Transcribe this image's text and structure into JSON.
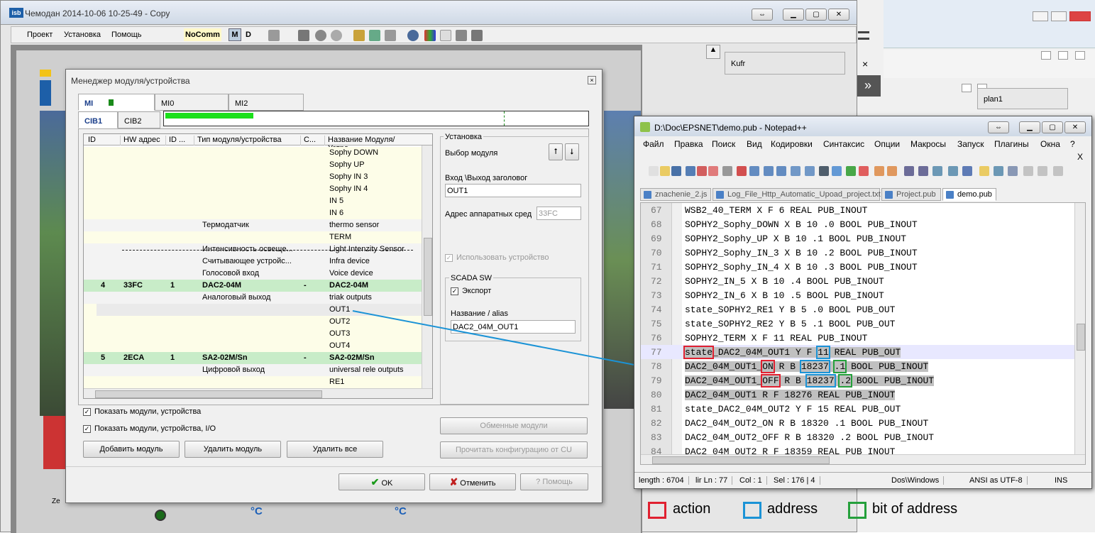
{
  "main": {
    "title": "Чемодан 2014-10-06 10-25-49 - Copy",
    "logo": "isb",
    "menu": [
      "Проект",
      "Установка",
      "Помощь"
    ],
    "nocomm": "NoComm",
    "mode_m": "M",
    "mode_d": "D"
  },
  "right_panel": {
    "kufr": "Kufr",
    "plan": "plan1"
  },
  "dialog": {
    "title": "Менеджер модуля/устройства",
    "tabs_top": [
      "MI",
      "MI0",
      "MI2"
    ],
    "tabs_bottom": [
      "CIB1",
      "CIB2"
    ],
    "columns": [
      "ID",
      "HW адрес",
      "ID ...",
      "Тип модуля/устройства",
      "C...",
      "Название Модуля/Устро..."
    ],
    "rows": [
      {
        "style": "y",
        "id": "",
        "hw": "",
        "idm": "",
        "type": "",
        "c": "",
        "name": "Sophy DOWN"
      },
      {
        "style": "y",
        "id": "",
        "hw": "",
        "idm": "",
        "type": "",
        "c": "",
        "name": "Sophy UP"
      },
      {
        "style": "y",
        "id": "",
        "hw": "",
        "idm": "",
        "type": "",
        "c": "",
        "name": "Sophy IN 3"
      },
      {
        "style": "y",
        "id": "",
        "hw": "",
        "idm": "",
        "type": "",
        "c": "",
        "name": "Sophy IN 4"
      },
      {
        "style": "y",
        "id": "",
        "hw": "",
        "idm": "",
        "type": "",
        "c": "",
        "name": "IN 5"
      },
      {
        "style": "y",
        "id": "",
        "hw": "",
        "idm": "",
        "type": "",
        "c": "",
        "name": "IN 6"
      },
      {
        "style": "w",
        "id": "",
        "hw": "",
        "idm": "",
        "type": "Термодатчик",
        "c": "",
        "name": "thermo sensor"
      },
      {
        "style": "y",
        "id": "",
        "hw": "",
        "idm": "",
        "type": "",
        "c": "",
        "name": "TERM"
      },
      {
        "style": "w",
        "id": "",
        "hw": "",
        "idm": "",
        "type": "Интенсивность освеще...",
        "c": "",
        "name": "Light Intenzity Sensor"
      },
      {
        "style": "w",
        "id": "",
        "hw": "",
        "idm": "",
        "type": "Считывающее устройс...",
        "c": "",
        "name": "Infra device"
      },
      {
        "style": "w",
        "id": "",
        "hw": "",
        "idm": "",
        "type": "Голосовой вход",
        "c": "",
        "name": "Voice device"
      },
      {
        "style": "g",
        "id": "4",
        "hw": "33FC",
        "idm": "1",
        "type": "DAC2-04M",
        "c": "-",
        "name": "DAC2-04M"
      },
      {
        "style": "w",
        "id": "",
        "hw": "",
        "idm": "",
        "type": "Аналоговый выход",
        "c": "",
        "name": "triak outputs"
      },
      {
        "style": "s",
        "id": "",
        "hw": "",
        "idm": "",
        "type": "",
        "c": "",
        "name": "OUT1"
      },
      {
        "style": "y",
        "id": "",
        "hw": "",
        "idm": "",
        "type": "",
        "c": "",
        "name": "OUT2"
      },
      {
        "style": "y",
        "id": "",
        "hw": "",
        "idm": "",
        "type": "",
        "c": "",
        "name": "OUT3"
      },
      {
        "style": "y",
        "id": "",
        "hw": "",
        "idm": "",
        "type": "",
        "c": "",
        "name": "OUT4"
      },
      {
        "style": "g",
        "id": "5",
        "hw": "2ECA",
        "idm": "1",
        "type": "SA2-02M/Sn",
        "c": "-",
        "name": "SA2-02M/Sn"
      },
      {
        "style": "w",
        "id": "",
        "hw": "",
        "idm": "",
        "type": "Цифровой выход",
        "c": "",
        "name": "universal rele outputs"
      },
      {
        "style": "y",
        "id": "",
        "hw": "",
        "idm": "",
        "type": "",
        "c": "",
        "name": "RE1"
      }
    ],
    "install_group": "Установка",
    "select_module": "Выбор модуля",
    "io_header_label": "Вход \\Выход заголовог",
    "io_header_value": "OUT1",
    "hw_addr_label": "Адрес аппаратных сред",
    "hw_addr_value": "33FC",
    "use_device": "Использовать устройство",
    "scada_group": "SCADA SW",
    "export": "Экспорт",
    "alias_label": "Название / alias",
    "alias_value": "DAC2_04M_OUT1",
    "show_modules": "Показать модули, устройства",
    "show_modules_io": "Показать модули, устройства, I/O",
    "add_module": "Добавить модуль",
    "delete_module": "Удалить модуль",
    "delete_all": "Удалить все",
    "exchange_modules": "Обменные модули",
    "read_config": "Прочитать конфигурацию от CU",
    "ok": "OK",
    "cancel": "Отменить",
    "help": "Помощь"
  },
  "npp": {
    "title": "D:\\Doc\\EPSNET\\demo.pub - Notepad++",
    "menu": [
      "Файл",
      "Правка",
      "Поиск",
      "Вид",
      "Кодировки",
      "Синтаксис",
      "Опции",
      "Макросы",
      "Запуск",
      "Плагины",
      "Окна",
      "?"
    ],
    "close_x": "X",
    "tabs": [
      "znachenie_2.js",
      "Log_File_Http_Automatic_Upoad_project.txt",
      "Project.pub",
      "demo.pub"
    ],
    "lines": [
      {
        "n": "67",
        "t": "WSB2_40_TERM X F 6 REAL PUB_INOUT"
      },
      {
        "n": "68",
        "t": "SOPHY2_Sophy_DOWN X B 10 .0 BOOL PUB_INOUT"
      },
      {
        "n": "69",
        "t": "SOPHY2_Sophy_UP X B 10 .1 BOOL PUB_INOUT"
      },
      {
        "n": "70",
        "t": "SOPHY2_Sophy_IN_3 X B 10 .2 BOOL PUB_INOUT"
      },
      {
        "n": "71",
        "t": "SOPHY2_Sophy_IN_4 X B 10 .3 BOOL PUB_INOUT"
      },
      {
        "n": "72",
        "t": "SOPHY2_IN_5 X B 10 .4 BOOL PUB_INOUT"
      },
      {
        "n": "73",
        "t": "SOPHY2_IN_6 X B 10 .5 BOOL PUB_INOUT"
      },
      {
        "n": "74",
        "t": "state_SOPHY2_RE1 Y B 5 .0 BOOL PUB_OUT"
      },
      {
        "n": "75",
        "t": "state_SOPHY2_RE2 Y B 5 .1 BOOL PUB_OUT"
      },
      {
        "n": "76",
        "t": "SOPHY2_TERM X F 11 REAL PUB_INOUT"
      },
      {
        "n": "77",
        "t": ""
      },
      {
        "n": "78",
        "t": ""
      },
      {
        "n": "79",
        "t": ""
      },
      {
        "n": "80",
        "t": "DAC2_04M_OUT1 R F 18276 REAL PUB_INOUT"
      },
      {
        "n": "81",
        "t": "state_DAC2_04M_OUT2 Y F 15 REAL PUB_OUT"
      },
      {
        "n": "82",
        "t": "DAC2_04M_OUT2_ON R B 18320 .1 BOOL PUB_INOUT"
      },
      {
        "n": "83",
        "t": "DAC2_04M_OUT2_OFF R B 18320 .2 BOOL PUB_INOUT"
      },
      {
        "n": "84",
        "t": "DAC2_04M_OUT2 R F 18359 REAL PUB_INOUT"
      }
    ],
    "l77": {
      "a": "state",
      "b": "_DAC2_04M_OUT1 Y F ",
      "c": "11",
      "d": " REAL PUB_OUT"
    },
    "l78": {
      "a": "DAC2_04M_OUT1_",
      "b": "ON",
      "c": " R B ",
      "d": "18237",
      "e": " ",
      "f": ".1",
      "g": " BOOL PUB_INOUT"
    },
    "l79": {
      "a": "DAC2_04M_OUT1_",
      "b": "OFF",
      "c": " R B ",
      "d": "18237",
      "e": " ",
      "f": ".2",
      "g": " BOOL PUB_INOUT"
    },
    "status": {
      "length": "length : 6704",
      "ln": "lir Ln : 77",
      "col": "Col : 1",
      "sel": "Sel : 176 | 4",
      "eol": "Dos\\Windows",
      "enc": "ANSI as UTF-8",
      "ins": "INS"
    }
  },
  "legend": {
    "action": "action",
    "address": "address",
    "bit": "bit of address",
    "colors": {
      "action": "#e02030",
      "address": "#1b93d6",
      "bit": "#25a03c"
    }
  },
  "celsius": "°C"
}
